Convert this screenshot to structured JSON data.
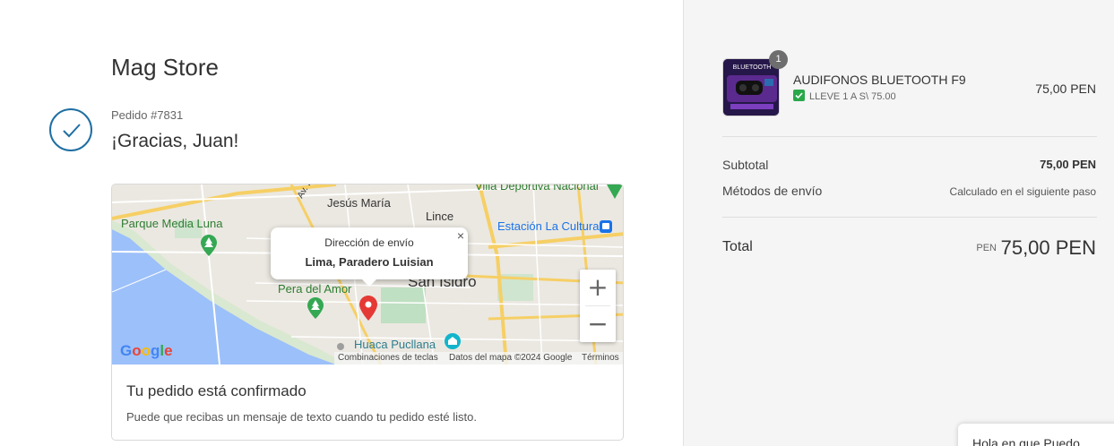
{
  "store": {
    "name": "Mag Store"
  },
  "order": {
    "number": "Pedido #7831",
    "thanks": "¡Gracias, Juan!"
  },
  "map": {
    "labels": {
      "jesus_maria": "Jesús María",
      "av_brasil": "Av. Brasil",
      "lince": "Lince",
      "villa_deportiva": "Villa Deportiva Nacional",
      "parque_media_luna": "Parque Media Luna",
      "estacion_la_cultura": "Estación La Cultura",
      "san_isidro": "San Isidro",
      "pera_del_amor": "Pera del Amor",
      "huaca_pucllana": "Huaca Pucllana",
      "partial_s": "S"
    },
    "info_window": {
      "title": "Dirección de envío",
      "address": "Lima, Paradero Luisian",
      "close": "×"
    },
    "zoom_in": "+",
    "zoom_out": "−",
    "google_logo": "Google",
    "attribution": {
      "shortcuts": "Combinaciones de teclas",
      "data": "Datos del mapa ©2024 Google",
      "terms": "Términos"
    },
    "icons": [
      "park-icon",
      "transit-icon",
      "museum-icon",
      "location-pin-icon"
    ]
  },
  "confirmation": {
    "title": "Tu pedido está confirmado",
    "text": "Puede que recibas un mensaje de texto cuando tu pedido esté listo."
  },
  "summary": {
    "item": {
      "quantity": "1",
      "name": "AUDIFONOS BLUETOOTH F9",
      "promo": "LLEVE 1 A S\\ 75.00",
      "price": "75,00 PEN",
      "thumb_text": "BLUETOOTH"
    },
    "subtotal_label": "Subtotal",
    "subtotal_value": "75,00 PEN",
    "shipping_label": "Métodos de envío",
    "shipping_value": "Calculado en el siguiente paso",
    "total_label": "Total",
    "total_currency": "PEN",
    "total_value": "75,00 PEN"
  },
  "chat": {
    "label": "Hola en que Puedo"
  },
  "colors": {
    "accent": "#1f6fa3",
    "success": "#2aa84a",
    "pin": "#e53935",
    "water": "#9cc0f9"
  }
}
